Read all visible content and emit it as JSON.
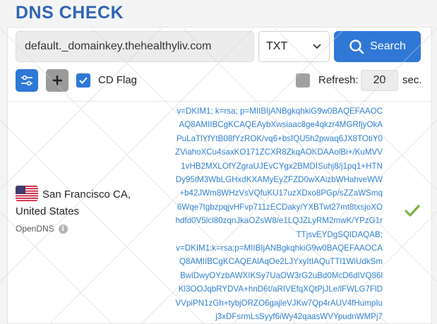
{
  "page": {
    "title": "DNS CHECK"
  },
  "search": {
    "domain_value": "default._domainkey.thehealthyliv.com",
    "record_type": "TXT",
    "button_label": "Search"
  },
  "options": {
    "cd_flag_label": "CD Flag",
    "cd_flag_checked": true,
    "refresh_label": "Refresh:",
    "refresh_checked": false,
    "refresh_value": "20",
    "refresh_unit": "sec."
  },
  "result": {
    "location": "San Francisco CA, United States",
    "provider": "OpenDNS",
    "status": "ok",
    "records": [
      "v=DKIM1; k=rsa; p=MIIBIjANBgkqhkiG9w0BAQEFAAOCAQ8AMIIBCgKCAQEAybXwsiaac8ge4qkzr4MGRfjyOkAPuLaTlYfYtB08fYzROK/vq6+bsfQU5h2pwaq6JX8TOtiY0ZViahoXCu4saxKO171ZCXR8ZkqAOKDAAolBi+/KuMVV1vHB2MXLOfYZgraUJEvCYgx2BMDISuhj8/j1pq1+HTNDy95tM3WbLGHxdKXAMyEyZFZD0wXAizbWHahveWW+b42JWm8WHzVsVQfuKU17uzXDxo8PGp/sZZaWSmq6Wqe7tgbzpqjvHFvp711zECDaky/YXBTwl27mt8txsjoXOhdfd0V5lcl80zqnJkaOZsW8/e1LQJZLyRM2mwK/YPzG1rTTjsvEYDgSQIDAQAB;",
      "v=DKIM1;k=rsa;p=MIIBIjANBgkqhkiG9w0BAQEFAAOCAQ8AMIIBCgKCAQEAlAqOe2LJYxyItIAQuTTl1WiUdkSmBwlDwyOYzbAWXIKSy7UaOW3rG2uBd0McD6dIVQ86lKl3OOJqbRYDVA+hnD6t/aRIVEfqXQtPjJLe/lFWLG7FlDVVpiPN1zGh+tybjORZO6gajleVJKw7Qp4rAUV4fHumpIuj3xDFsrmLsSyyf6iWy42qaasWVYpudnWMPj7"
    ]
  },
  "colors": {
    "accent": "#2f78d6",
    "title": "#2f65b4",
    "record_text": "#2f7fcf",
    "check_green": "#7cb342"
  },
  "icons": {
    "settings": "sliders-icon",
    "add": "plus-icon",
    "search": "search-icon",
    "dropdown": "chevron-down-icon",
    "status": "checkmark-icon",
    "info": "info-icon",
    "flag": "us-flag-icon"
  }
}
